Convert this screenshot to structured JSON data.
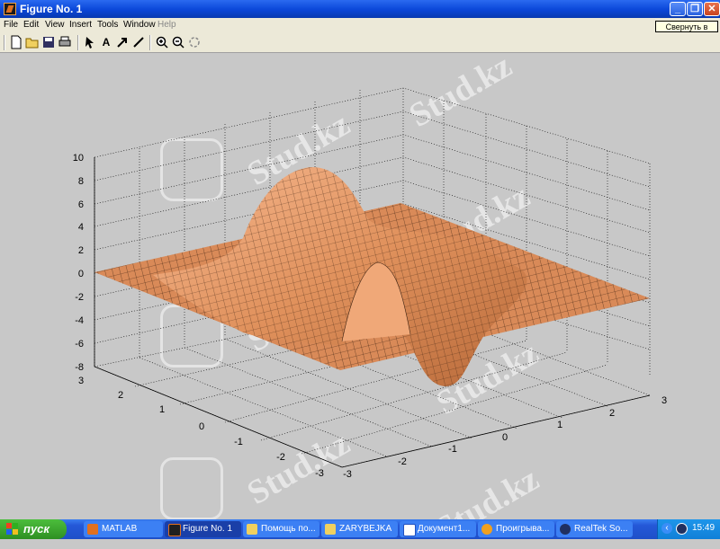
{
  "window": {
    "title": "Figure No. 1",
    "tooltip": "Свернуть в окно"
  },
  "menu": [
    "File",
    "Edit",
    "View",
    "Insert",
    "Tools",
    "Window",
    "Help"
  ],
  "toolbar": [
    "new-file",
    "open-folder",
    "save",
    "print",
    "select-arrow",
    "insert-text",
    "insert-arrow",
    "insert-line",
    "zoom-in",
    "zoom-out",
    "rotate-3d"
  ],
  "watermark": "Stud.kz",
  "axes": {
    "z_ticks": [
      "10",
      "8",
      "6",
      "4",
      "2",
      "0",
      "-2",
      "-4",
      "-6",
      "-8"
    ],
    "y_ticks": [
      "3",
      "2",
      "1",
      "0",
      "-1",
      "-2",
      "-3"
    ],
    "x_ticks": [
      "-3",
      "-2",
      "-1",
      "0",
      "1",
      "2",
      "3"
    ]
  },
  "taskbar": {
    "start": "пуск",
    "tasks": [
      "MATLAB",
      "Figure No. 1",
      "Помощь по...",
      "ZARYBEJKA",
      "Документ1...",
      "Проигрыва...",
      "RealTek So..."
    ],
    "clock": "15:49"
  },
  "colors": {
    "surface": "#e8a070",
    "background": "#c8c8c8"
  }
}
